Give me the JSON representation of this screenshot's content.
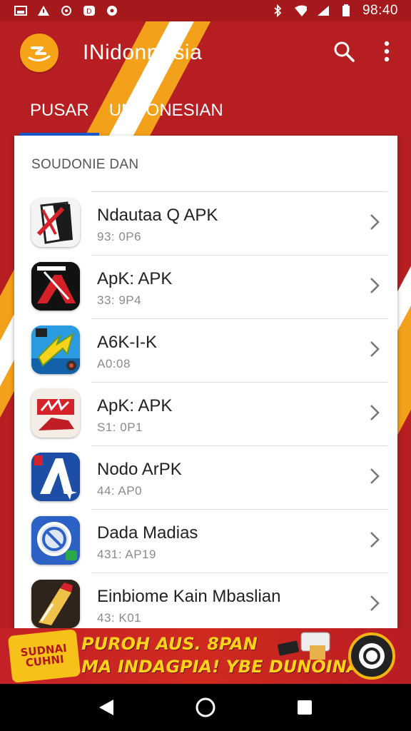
{
  "status_bar": {
    "time": "98:40",
    "left_icons": [
      "gallery-icon",
      "warning-icon",
      "settings-icon",
      "app-icon",
      "record-icon"
    ],
    "right_icons": [
      "bluetooth-icon",
      "wifi-icon",
      "signal-icon",
      "battery-icon"
    ]
  },
  "app_bar": {
    "title": "INidonnAsia",
    "logo_icon": "app-logo-icon",
    "actions": [
      "search-icon",
      "more-vert-icon"
    ]
  },
  "tabs": [
    {
      "label": "PUSAR",
      "active": true
    },
    {
      "label": "UNDONESIAN",
      "active": false
    }
  ],
  "section_title": "SOUDONIE DAN",
  "items": [
    {
      "name": "Ndautaa  Q APK",
      "sub": "93: 0P6",
      "icon": "document-app-icon"
    },
    {
      "name": "ApK: APK",
      "sub": "33: 9P4",
      "icon": "red-a-app-icon"
    },
    {
      "name": "A6K-I-K",
      "sub": "A0:08",
      "icon": "arrow-app-icon"
    },
    {
      "name": "ApK: APK",
      "sub": "S1: 0P1",
      "icon": "red-bolt-app-icon"
    },
    {
      "name": "Nodo ArPK",
      "sub": "44: AP0",
      "icon": "blue-a-app-icon"
    },
    {
      "name": "Dada Madias",
      "sub": "431: AP19",
      "icon": "blue-ring-app-icon"
    },
    {
      "name": "Einbiome Kain Mbaslian",
      "sub": "43: K01",
      "icon": "brush-app-icon"
    }
  ],
  "banner": {
    "badge": "SUDNAI CUHNI",
    "line1": "PUROH AUS. 8PAN",
    "line2": "MA INDAGPIA! YBE DUNOINA!",
    "seal_icon": "seal-badge-icon"
  },
  "nav_bar": [
    "back-icon",
    "home-icon",
    "recents-icon"
  ],
  "colors": {
    "primary": "#b61e22",
    "accent": "#f7a318",
    "tab_indicator": "#1a5bd0",
    "banner_text": "#ffd21c"
  }
}
